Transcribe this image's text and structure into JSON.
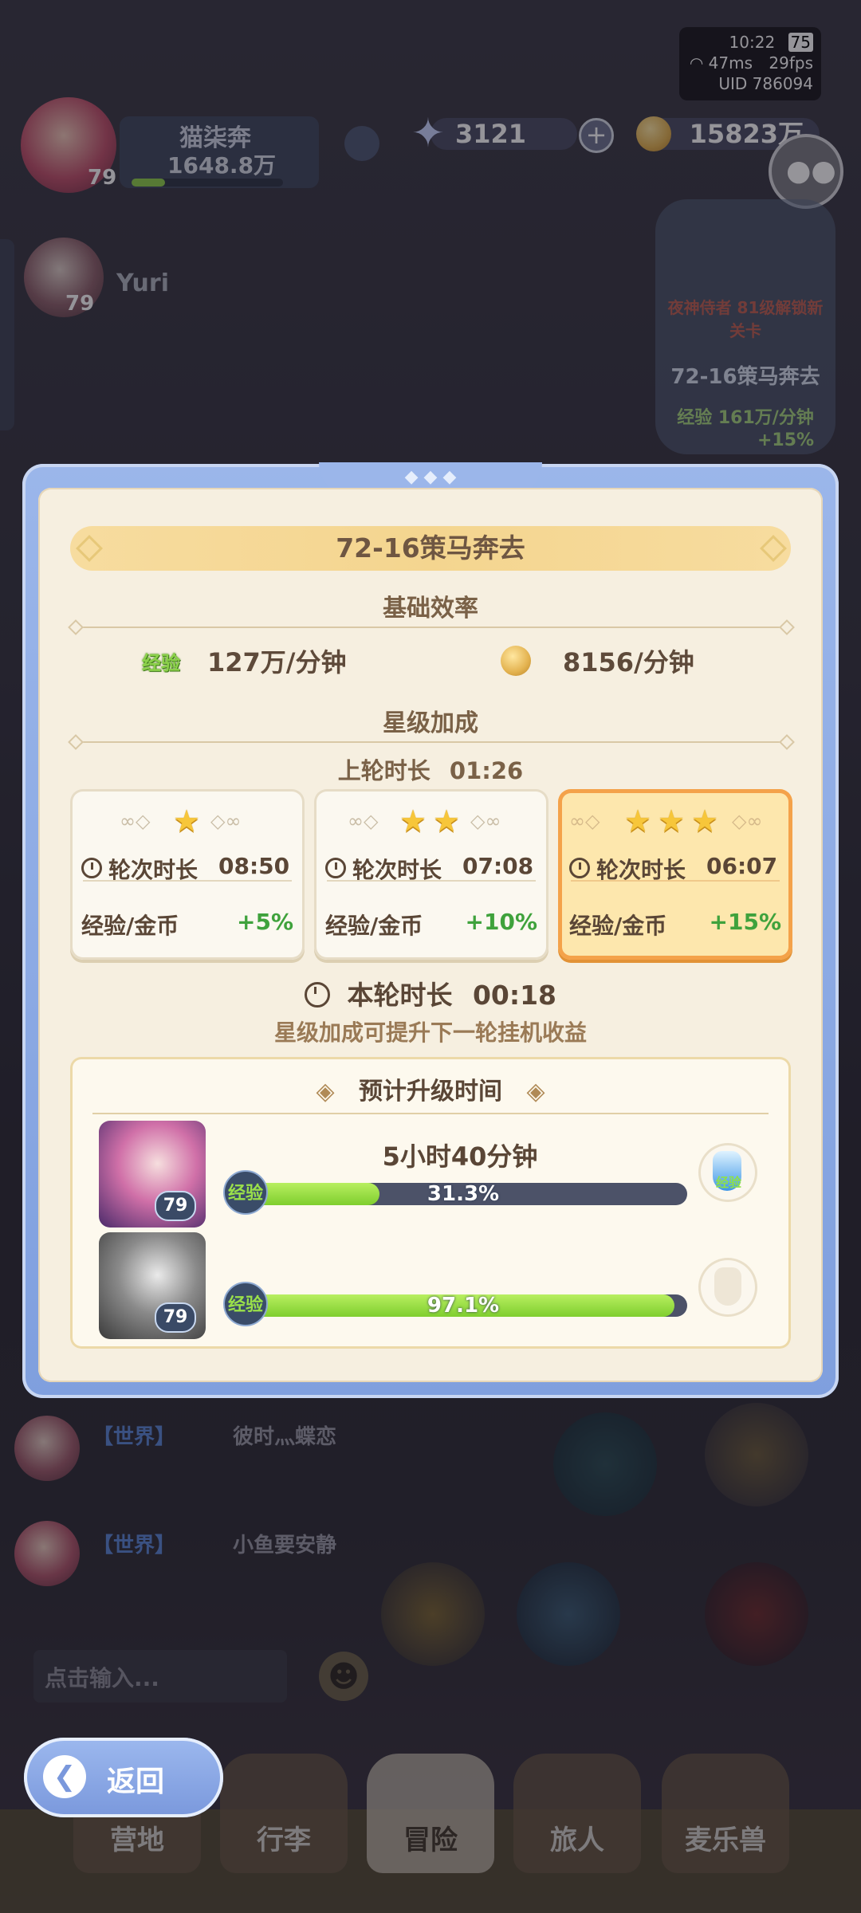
{
  "status": {
    "time": "10:22",
    "battery": "75",
    "ping": "47ms",
    "fps": "29fps",
    "uid": "UID 786094"
  },
  "top_bar": {
    "player_name": "猫柒奔",
    "power": "1648.8万",
    "player_level": "79",
    "diamonds": "3121",
    "gold": "15823万",
    "friend_name": "Yuri",
    "friend_level": "79"
  },
  "side_panel": {
    "notice": "夜神侍者 81级解锁新关卡",
    "stage": "72-16策马奔去",
    "exp_rate": "经验 161万/分钟",
    "bonus": "+15%"
  },
  "modal": {
    "title": "72-16策马奔去",
    "base_efficiency": {
      "heading": "基础效率",
      "exp_tag": "经验",
      "exp_rate": "127万/分钟",
      "gold_rate": "8156/分钟"
    },
    "star_bonus": {
      "heading": "星级加成",
      "last_round_label": "上轮时长",
      "last_round_time": "01:26",
      "cards": [
        {
          "stars": 1,
          "round_label": "轮次时长",
          "round_time": "08:50",
          "reward_label": "经验/金币",
          "bonus": "+5%"
        },
        {
          "stars": 2,
          "round_label": "轮次时长",
          "round_time": "07:08",
          "reward_label": "经验/金币",
          "bonus": "+10%"
        },
        {
          "stars": 3,
          "round_label": "轮次时长",
          "round_time": "06:07",
          "reward_label": "经验/金币",
          "bonus": "+15%"
        }
      ],
      "current_round_label": "本轮时长",
      "current_round_time": "00:18",
      "hint": "星级加成可提升下一轮挂机收益"
    },
    "predict": {
      "heading": "预计升级时间",
      "heroes": [
        {
          "time": "5小时40分钟",
          "exp_tag": "经验",
          "progress_text": "31.3%",
          "progress": 31.3,
          "level": "79",
          "potion_label": "经验"
        },
        {
          "time": "",
          "exp_tag": "经验",
          "progress_text": "97.1%",
          "progress": 97.1,
          "level": "79",
          "potion_label": ""
        }
      ]
    }
  },
  "chat": {
    "messages": [
      {
        "channel": "【世界】",
        "text": "彼时灬蝶恋"
      },
      {
        "channel": "【世界】",
        "text": "小鱼要安静"
      }
    ],
    "input_placeholder": "点击输入..."
  },
  "bottom_nav": {
    "back": "返回",
    "tabs": [
      "营地",
      "行李",
      "冒险",
      "旅人",
      "麦乐兽"
    ]
  }
}
